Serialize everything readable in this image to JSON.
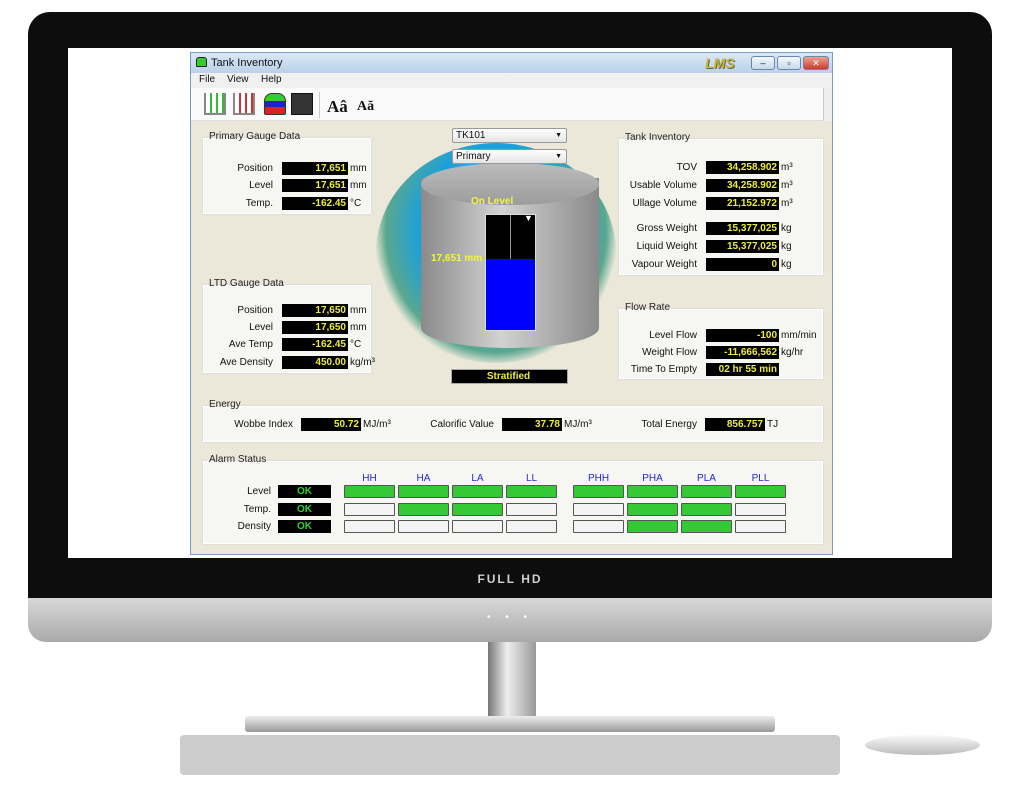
{
  "monitor": {
    "brand": "FULL HD",
    "dots": "• • •"
  },
  "window": {
    "title": "Tank Inventory",
    "logo": "LMS",
    "minimize": "–",
    "maximize": "▫",
    "close": "✕"
  },
  "menu": [
    "File",
    "View",
    "Help"
  ],
  "toolbar": {
    "icons": [
      "tank-trend-green-icon",
      "tank-trend-red-icon",
      "tank-status-icon",
      "tank-calculator-icon",
      "font-increase-icon",
      "font-decrease-icon"
    ],
    "font_up": "Aâ",
    "font_down": "Aă"
  },
  "selectors": {
    "tank": "TK101",
    "gauge": "Primary"
  },
  "tank_graphic": {
    "status": "On Level",
    "level_text": "17,651 mm",
    "fill_percent": 62,
    "condition": "Stratified",
    "colors": {
      "liquid": "#0000ff",
      "label": "#f5f53a"
    }
  },
  "primary_gauge": {
    "title": "Primary Gauge Data",
    "rows": [
      {
        "label": "Position",
        "value": "17,651",
        "unit": "mm"
      },
      {
        "label": "Level",
        "value": "17,651",
        "unit": "mm"
      },
      {
        "label": "Temp.",
        "value": "-162.45",
        "unit": "°C"
      }
    ]
  },
  "ltd_gauge": {
    "title": "LTD Gauge Data",
    "rows": [
      {
        "label": "Position",
        "value": "17,650",
        "unit": "mm"
      },
      {
        "label": "Level",
        "value": "17,650",
        "unit": "mm"
      },
      {
        "label": "Ave Temp",
        "value": "-162.45",
        "unit": "°C"
      },
      {
        "label": "Ave Density",
        "value": "450.00",
        "unit": "kg/m³"
      }
    ]
  },
  "tank_inventory": {
    "title": "Tank Inventory",
    "rows": [
      {
        "label": "TOV",
        "value": "34,258.902",
        "unit": "m³"
      },
      {
        "label": "Usable Volume",
        "value": "34,258.902",
        "unit": "m³"
      },
      {
        "label": "Ullage Volume",
        "value": "21,152.972",
        "unit": "m³"
      },
      {
        "label": "Gross Weight",
        "value": "15,377,025",
        "unit": "kg"
      },
      {
        "label": "Liquid Weight",
        "value": "15,377,025",
        "unit": "kg"
      },
      {
        "label": "Vapour Weight",
        "value": "0",
        "unit": "kg"
      }
    ]
  },
  "flow_rate": {
    "title": "Flow Rate",
    "rows": [
      {
        "label": "Level Flow",
        "value": "-100",
        "unit": "mm/min"
      },
      {
        "label": "Weight Flow",
        "value": "-11,666,562",
        "unit": "kg/hr"
      },
      {
        "label": "Time To Empty",
        "value": "02 hr 55 min",
        "unit": ""
      }
    ]
  },
  "energy": {
    "title": "Energy",
    "items": [
      {
        "label": "Wobbe Index",
        "value": "50.72",
        "unit": "MJ/m³"
      },
      {
        "label": "Calorific Value",
        "value": "37.78",
        "unit": "MJ/m³"
      },
      {
        "label": "Total Energy",
        "value": "856.757",
        "unit": "TJ"
      }
    ]
  },
  "alarm": {
    "title": "Alarm Status",
    "headers": [
      "HH",
      "HA",
      "LA",
      "LL",
      "PHH",
      "PHA",
      "PLA",
      "PLL"
    ],
    "rows": [
      {
        "label": "Level",
        "status": "OK",
        "states": [
          1,
          1,
          1,
          1,
          1,
          1,
          1,
          1
        ]
      },
      {
        "label": "Temp.",
        "status": "OK",
        "states": [
          0,
          1,
          1,
          0,
          0,
          1,
          1,
          0
        ]
      },
      {
        "label": "Density",
        "status": "OK",
        "states": [
          0,
          0,
          0,
          0,
          0,
          1,
          1,
          0
        ]
      }
    ],
    "colors": {
      "active": "#35c935",
      "inactive": "#f4f4f4",
      "ok_text": "#2ed12e"
    }
  }
}
